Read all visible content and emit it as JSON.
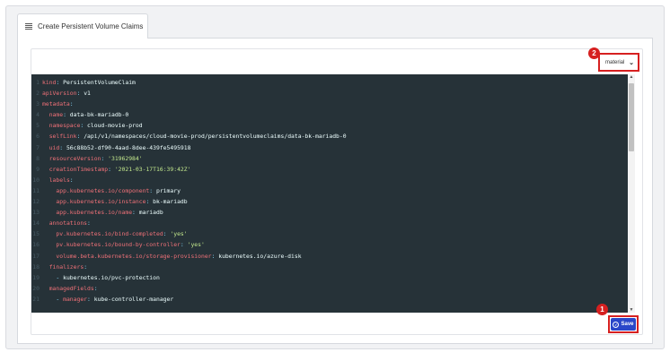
{
  "tab": {
    "label": "Create Persistent Volume Claims"
  },
  "theme_select": {
    "value": "material"
  },
  "markers": {
    "save": "1",
    "theme": "2"
  },
  "save_button": {
    "label": "Save"
  },
  "code_lines": [
    {
      "n": "1",
      "segs": [
        {
          "t": "kind",
          "c": "k"
        },
        {
          "t": ": ",
          "c": "p"
        },
        {
          "t": "PersistentVolumeClaim",
          "c": "v"
        }
      ]
    },
    {
      "n": "2",
      "segs": [
        {
          "t": "apiVersion",
          "c": "k"
        },
        {
          "t": ": ",
          "c": "p"
        },
        {
          "t": "v1",
          "c": "v"
        }
      ]
    },
    {
      "n": "3",
      "segs": [
        {
          "t": "metadata",
          "c": "k"
        },
        {
          "t": ":",
          "c": "p"
        }
      ]
    },
    {
      "n": "4",
      "segs": [
        {
          "t": "  "
        },
        {
          "t": "name",
          "c": "k"
        },
        {
          "t": ": ",
          "c": "p"
        },
        {
          "t": "data-bk-mariadb-0",
          "c": "v"
        }
      ]
    },
    {
      "n": "5",
      "segs": [
        {
          "t": "  "
        },
        {
          "t": "namespace",
          "c": "k"
        },
        {
          "t": ": ",
          "c": "p"
        },
        {
          "t": "cloud-movie-prod",
          "c": "v"
        }
      ]
    },
    {
      "n": "6",
      "segs": [
        {
          "t": "  "
        },
        {
          "t": "selfLink",
          "c": "k"
        },
        {
          "t": ": ",
          "c": "p"
        },
        {
          "t": "/api/v1/namespaces/cloud-movie-prod/persistentvolumeclaims/data-bk-mariadb-0",
          "c": "v"
        }
      ]
    },
    {
      "n": "7",
      "segs": [
        {
          "t": "  "
        },
        {
          "t": "uid",
          "c": "k"
        },
        {
          "t": ": ",
          "c": "p"
        },
        {
          "t": "56c88b52-df90-4aad-8dee-439fe5495918",
          "c": "v"
        }
      ]
    },
    {
      "n": "8",
      "segs": [
        {
          "t": "  "
        },
        {
          "t": "resourceVersion",
          "c": "k"
        },
        {
          "t": ": ",
          "c": "p"
        },
        {
          "t": "'31962984'",
          "c": "s"
        }
      ]
    },
    {
      "n": "9",
      "segs": [
        {
          "t": "  "
        },
        {
          "t": "creationTimestamp",
          "c": "k"
        },
        {
          "t": ": ",
          "c": "p"
        },
        {
          "t": "'2021-03-17T16:39:42Z'",
          "c": "s"
        }
      ]
    },
    {
      "n": "10",
      "segs": [
        {
          "t": "  "
        },
        {
          "t": "labels",
          "c": "k"
        },
        {
          "t": ":",
          "c": "p"
        }
      ]
    },
    {
      "n": "11",
      "segs": [
        {
          "t": "    "
        },
        {
          "t": "app.kubernetes.io/component",
          "c": "k"
        },
        {
          "t": ": ",
          "c": "p"
        },
        {
          "t": "primary",
          "c": "v"
        }
      ]
    },
    {
      "n": "12",
      "segs": [
        {
          "t": "    "
        },
        {
          "t": "app.kubernetes.io/instance",
          "c": "k"
        },
        {
          "t": ": ",
          "c": "p"
        },
        {
          "t": "bk-mariadb",
          "c": "v"
        }
      ]
    },
    {
      "n": "13",
      "segs": [
        {
          "t": "    "
        },
        {
          "t": "app.kubernetes.io/name",
          "c": "k"
        },
        {
          "t": ": ",
          "c": "p"
        },
        {
          "t": "mariadb",
          "c": "v"
        }
      ]
    },
    {
      "n": "14",
      "segs": [
        {
          "t": "  "
        },
        {
          "t": "annotations",
          "c": "k"
        },
        {
          "t": ":",
          "c": "p"
        }
      ]
    },
    {
      "n": "15",
      "segs": [
        {
          "t": "    "
        },
        {
          "t": "pv.kubernetes.io/bind-completed",
          "c": "k"
        },
        {
          "t": ": ",
          "c": "p"
        },
        {
          "t": "'yes'",
          "c": "s"
        }
      ]
    },
    {
      "n": "16",
      "segs": [
        {
          "t": "    "
        },
        {
          "t": "pv.kubernetes.io/bound-by-controller",
          "c": "k"
        },
        {
          "t": ": ",
          "c": "p"
        },
        {
          "t": "'yes'",
          "c": "s"
        }
      ]
    },
    {
      "n": "17",
      "segs": [
        {
          "t": "    "
        },
        {
          "t": "volume.beta.kubernetes.io/storage-provisioner",
          "c": "k"
        },
        {
          "t": ": ",
          "c": "p"
        },
        {
          "t": "kubernetes.io/azure-disk",
          "c": "v"
        }
      ]
    },
    {
      "n": "18",
      "segs": [
        {
          "t": "  "
        },
        {
          "t": "finalizers",
          "c": "k"
        },
        {
          "t": ":",
          "c": "p"
        }
      ]
    },
    {
      "n": "19",
      "segs": [
        {
          "t": "    "
        },
        {
          "t": "- ",
          "c": "p"
        },
        {
          "t": "kubernetes.io/pvc-protection",
          "c": "v"
        }
      ]
    },
    {
      "n": "20",
      "segs": [
        {
          "t": "  "
        },
        {
          "t": "managedFields",
          "c": "k"
        },
        {
          "t": ":",
          "c": "p"
        }
      ]
    },
    {
      "n": "21",
      "segs": [
        {
          "t": "    "
        },
        {
          "t": "- ",
          "c": "p"
        },
        {
          "t": "manager",
          "c": "k"
        },
        {
          "t": ": ",
          "c": "p"
        },
        {
          "t": "kube-controller-manager",
          "c": "v"
        }
      ]
    }
  ]
}
